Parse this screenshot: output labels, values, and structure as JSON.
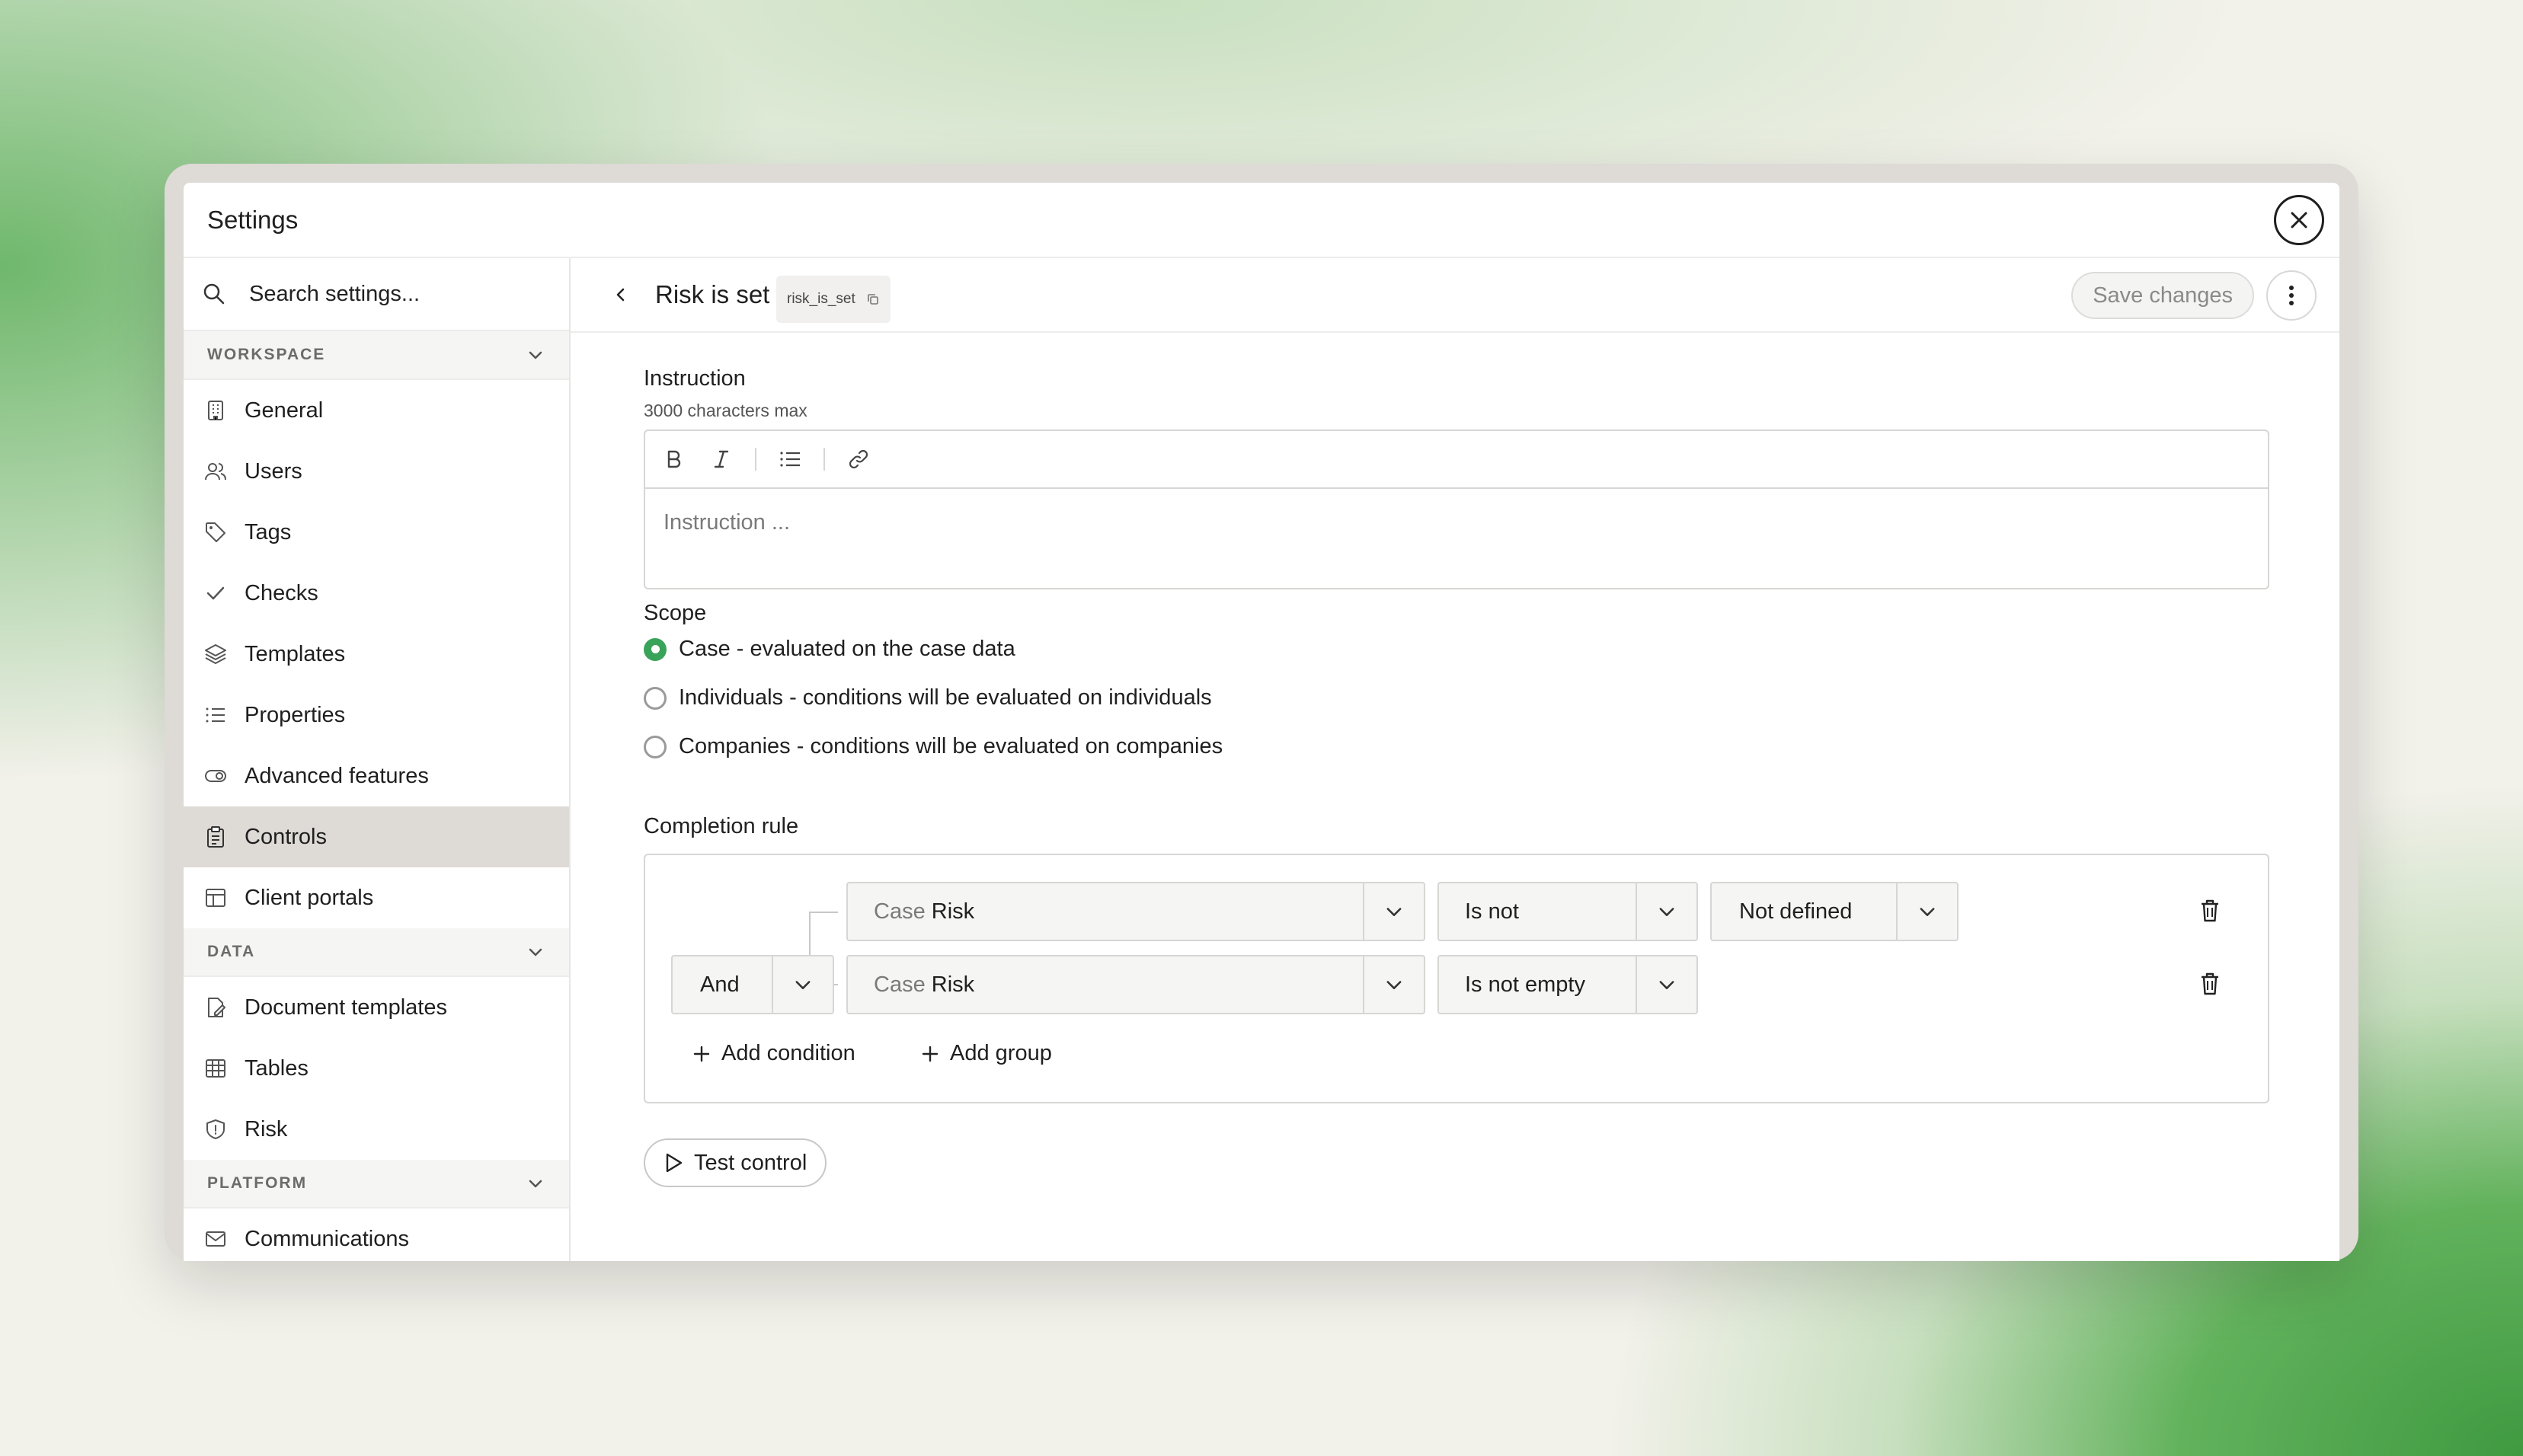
{
  "window": {
    "title": "Settings"
  },
  "sidebar": {
    "search_placeholder": "Search settings...",
    "sections": [
      {
        "header": "WORKSPACE",
        "items": [
          {
            "label": "General",
            "icon": "building-icon"
          },
          {
            "label": "Users",
            "icon": "users-icon"
          },
          {
            "label": "Tags",
            "icon": "tag-icon"
          },
          {
            "label": "Checks",
            "icon": "check-icon"
          },
          {
            "label": "Templates",
            "icon": "layers-icon"
          },
          {
            "label": "Properties",
            "icon": "list-icon"
          },
          {
            "label": "Advanced features",
            "icon": "toggle-icon"
          },
          {
            "label": "Controls",
            "icon": "clipboard-icon",
            "active": true
          },
          {
            "label": "Client portals",
            "icon": "layout-icon"
          }
        ]
      },
      {
        "header": "DATA",
        "items": [
          {
            "label": "Document templates",
            "icon": "file-edit-icon"
          },
          {
            "label": "Tables",
            "icon": "table-icon"
          },
          {
            "label": "Risk",
            "icon": "shield-icon"
          }
        ]
      },
      {
        "header": "PLATFORM",
        "items": [
          {
            "label": "Communications",
            "icon": "mail-icon"
          }
        ]
      }
    ]
  },
  "header": {
    "title": "Risk is set",
    "slug": "risk_is_set",
    "save_label": "Save changes"
  },
  "instruction": {
    "label": "Instruction",
    "hint": "3000 characters max",
    "placeholder": "Instruction ..."
  },
  "scope": {
    "label": "Scope",
    "options": [
      {
        "label": "Case - evaluated on the case data",
        "selected": true
      },
      {
        "label": "Individuals - conditions will be evaluated on individuals",
        "selected": false
      },
      {
        "label": "Companies - conditions will be evaluated on companies",
        "selected": false
      }
    ]
  },
  "completion_rule": {
    "label": "Completion rule",
    "conditions": [
      {
        "field_prefix": "Case",
        "field": "Risk",
        "operator": "Is not",
        "value": "Not defined"
      },
      {
        "connector": "And",
        "field_prefix": "Case",
        "field": "Risk",
        "operator": "Is not empty"
      }
    ],
    "add_condition_label": "Add condition",
    "add_group_label": "Add group"
  },
  "test_label": "Test control",
  "colors": {
    "accent": "#3aa35a",
    "active_bg": "#dedad6"
  }
}
